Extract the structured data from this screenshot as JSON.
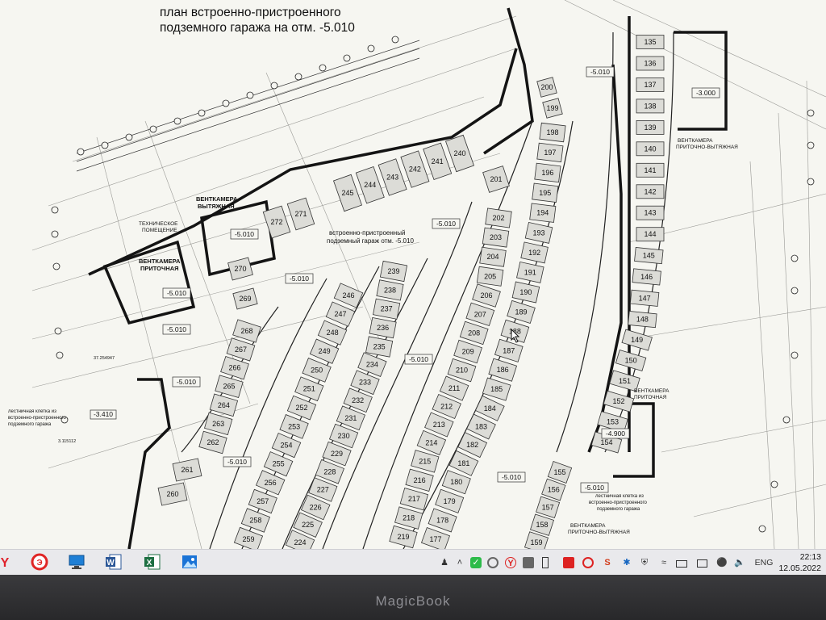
{
  "drawing": {
    "title_line1": "план встроенно-пристроенного",
    "title_line2": "подземного гаража на отм. -5.010",
    "parking_label_line1": "встроенно-пристроенный",
    "parking_label_line2": "подземный гараж отм. -5.010",
    "room_labels": {
      "techroom_1": "ТЕХНИЧЕСКОЕ",
      "techroom_2": "ПОМЕЩЕНИЕ",
      "vent_exhaust_1": "ВЕНТКАМЕРА",
      "vent_exhaust_2": "ВЫТЯЖНАЯ",
      "vent_supply_1": "ВЕНТКАМЕРА",
      "vent_supply_2": "ПРИТОЧНАЯ",
      "vent_supply_exhaust_1": "ВЕНТКАМЕРА",
      "vent_supply_exhaust_2": "ПРИТОЧНО-ВЫТЯЖНАЯ",
      "vent_right_mid_1": "ВЕНТКАМЕРА",
      "vent_right_mid_2": "ПРИТОЧНАЯ",
      "vent_right_low_1": "ВЕНТКАМЕРА",
      "vent_right_low_2": "ПРИТОЧНО-ВЫТЯЖНАЯ",
      "stair_left_1": "лестничная клетка из",
      "stair_left_2": "встроенно-пристроенного",
      "stair_left_3": "подземного гаража",
      "stair_right_1": "лестничная клетка из",
      "stair_right_2": "встроенно-пристроенного",
      "stair_right_3": "подземного гаража"
    },
    "level_marks": {
      "m1": "-5.010",
      "m2": "-5.010",
      "m3": "-5.010",
      "m4": "-5.010",
      "m5": "-5.010",
      "m6": "-5.010",
      "m7": "-5.010",
      "m8": "-5.010",
      "m9": "-5.010",
      "m10": "-5.010",
      "m11": "-3.000",
      "m12": "-4.900",
      "m13": "-3.410",
      "m14": "-5.010"
    },
    "misc_notes": {
      "n1": "37.254947",
      "n2": "3.115112"
    },
    "rows": {
      "row_a": [
        "135",
        "136",
        "137",
        "138",
        "139",
        "140",
        "141",
        "142",
        "143",
        "144",
        "145",
        "146",
        "147",
        "148",
        "149",
        "150",
        "151",
        "152",
        "153",
        "154"
      ],
      "row_b": [
        "198",
        "197",
        "196",
        "195",
        "194",
        "193",
        "192",
        "191",
        "190",
        "189",
        "188",
        "187",
        "186",
        "185",
        "184",
        "183",
        "182",
        "181",
        "180",
        "179",
        "178",
        "177"
      ],
      "row_c": [
        "202",
        "203",
        "204",
        "205",
        "206",
        "207",
        "208",
        "209",
        "210",
        "211",
        "212",
        "213",
        "214",
        "215",
        "216",
        "217",
        "218",
        "219"
      ],
      "row_d": [
        "239",
        "238",
        "237",
        "236",
        "235",
        "234",
        "233",
        "232",
        "231",
        "230",
        "229",
        "228",
        "227",
        "226",
        "225",
        "224"
      ],
      "row_e": [
        "246",
        "247",
        "248",
        "249",
        "250",
        "251",
        "252",
        "253",
        "254",
        "255",
        "256",
        "257",
        "258",
        "259"
      ],
      "row_f": [
        "268",
        "267",
        "266",
        "265",
        "264",
        "263",
        "262"
      ],
      "row_g": [
        "245",
        "244",
        "243",
        "242",
        "241",
        "240"
      ],
      "row_h": [
        "200",
        "199"
      ],
      "row_i": [
        "155",
        "156",
        "157",
        "158",
        "159"
      ],
      "row_j": [
        "272",
        "271"
      ],
      "singles": {
        "s201": "201",
        "s261": "261",
        "s260": "260",
        "s270": "270",
        "s269": "269"
      }
    }
  },
  "taskbar": {
    "apps": [
      "yandex-browser-icon",
      "antivirus-icon",
      "computer-icon",
      "word-icon",
      "excel-icon",
      "photos-icon"
    ],
    "language": "ENG",
    "time": "22:13",
    "date": "12.05.2022"
  },
  "device": {
    "brand": "MagicBook"
  },
  "colors": {
    "paper": "#f6f6f1",
    "stall_fill": "#dcdcd7",
    "line": "#1a1a1a",
    "taskbar": "#e9e9ec",
    "bezel": "#2e2e30"
  }
}
